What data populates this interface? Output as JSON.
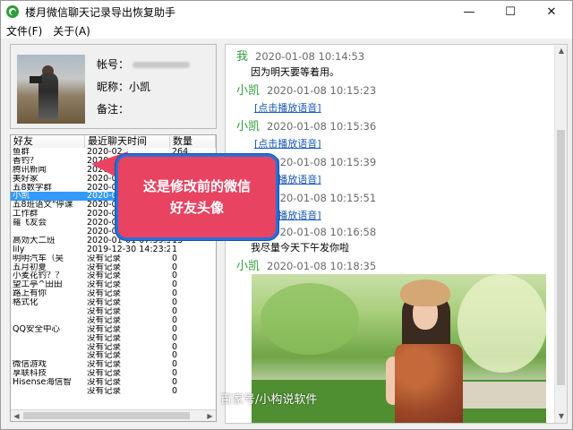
{
  "window": {
    "title": "楼月微信聊天记录导出恢复助手",
    "controls": {
      "minimize": "—",
      "maximize": "☐",
      "close": "✕"
    }
  },
  "menu": {
    "file": "文件(F)",
    "about": "关于(A)"
  },
  "profile": {
    "account_label": "帐号：",
    "nickname_label": "昵称：",
    "nickname_value": "小凯",
    "remark_label": "备注："
  },
  "friend_list": {
    "headers": {
      "friend": "好友",
      "last_chat": "最近聊天时间",
      "count": "数量"
    },
    "rows": [
      {
        "friend": "鱼群",
        "time": "2020-02",
        "count": "264"
      },
      {
        "friend": "香钓？",
        "time": "2020-02",
        "count": ""
      },
      {
        "friend": "腾讯新闻",
        "time": "2020-02",
        "count": ""
      },
      {
        "friend": "美好家",
        "time": "2020-02",
        "count": ""
      },
      {
        "friend": "五8数学群",
        "time": "2020-02",
        "count": ""
      },
      {
        "friend": "小凯",
        "time": "2020-02",
        "count": ""
      },
      {
        "friend": "五8班语文\"停课",
        "time": "2020-02",
        "count": ""
      },
      {
        "friend": "工作群",
        "time": "2020-02",
        "count": ""
      },
      {
        "friend": "羅飞友会",
        "time": "2020-02",
        "count": ""
      },
      {
        "friend": "",
        "time": "2020-01-08 15:43:19",
        "count": "59"
      },
      {
        "friend": "高効大二班",
        "time": "2020-01-01 07:39:55",
        "count": "13"
      },
      {
        "friend": "lily",
        "time": "2019-12-30 14:23:22",
        "count": "1"
      },
      {
        "friend": "明明汽车（吴",
        "time": "没有记录",
        "count": "0"
      },
      {
        "friend": "五月初夏",
        "time": "没有记录",
        "count": "0"
      },
      {
        "friend": "小麦花钓？？",
        "time": "没有记录",
        "count": "0"
      },
      {
        "friend": "望工亭^田田",
        "time": "没有记录",
        "count": "0"
      },
      {
        "friend": "路上有你",
        "time": "没有记录",
        "count": "0"
      },
      {
        "friend": "格式化",
        "time": "没有记录",
        "count": "0"
      },
      {
        "friend": "",
        "time": "没有记录",
        "count": "0"
      },
      {
        "friend": "",
        "time": "没有记录",
        "count": "0"
      },
      {
        "friend": "QQ安全中心",
        "time": "没有记录",
        "count": "0"
      },
      {
        "friend": "",
        "time": "没有记录",
        "count": "0"
      },
      {
        "friend": "",
        "time": "没有记录",
        "count": "0"
      },
      {
        "friend": "",
        "time": "没有记录",
        "count": "0"
      },
      {
        "friend": "微信游戏",
        "time": "没有记录",
        "count": "0"
      },
      {
        "friend": "享联科技",
        "time": "没有记录",
        "count": "0"
      },
      {
        "friend": "Hisense海信智",
        "time": "没有记录",
        "count": "0"
      },
      {
        "friend": "",
        "time": "没有记录",
        "count": "0"
      }
    ],
    "selected_index": 5
  },
  "chat": {
    "messages": [
      {
        "sender": "我",
        "time": "2020-01-08 10:14:53",
        "text": "因为明天要等着用。"
      },
      {
        "sender": "小凯",
        "time": "2020-01-08 10:15:23",
        "link": "[点击播放语音]"
      },
      {
        "sender": "小凯",
        "time": "2020-01-08 10:15:36",
        "link": "[点击播放语音]"
      },
      {
        "sender": "小凯",
        "time": "2020-01-08 10:15:39",
        "link": "[点击播放语音]"
      },
      {
        "sender": "小凯",
        "time": "2020-01-08 10:15:51",
        "link": "[点击播放语音]"
      },
      {
        "sender": "小凯",
        "time": "2020-01-08 10:16:58",
        "text": "我尽量今天下午发你啦"
      },
      {
        "sender": "小凯",
        "time": "2020-01-08 10:18:35"
      }
    ]
  },
  "annotation": {
    "line1": "这是修改前的微信",
    "line2": "好友头像",
    "color": "#e84361",
    "border": "#2b6fd6"
  },
  "watermark": "百家号/小构说软件"
}
